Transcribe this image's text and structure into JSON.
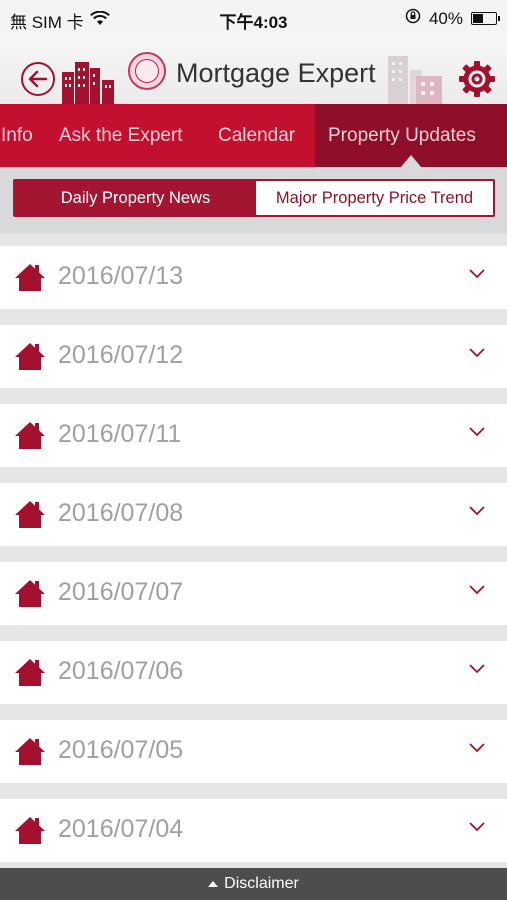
{
  "status_bar": {
    "carrier": "無 SIM 卡",
    "time": "下午4:03",
    "battery": "40%",
    "icons": [
      "wifi-icon",
      "orientation-lock-icon",
      "battery-icon"
    ]
  },
  "header": {
    "title": "Mortgage Expert",
    "icons": [
      "back-icon",
      "city-buildings-icon",
      "logo-seal",
      "gear-icon"
    ]
  },
  "tabs": [
    {
      "label": "Info"
    },
    {
      "label": "Ask the Expert"
    },
    {
      "label": "Calendar"
    },
    {
      "label": "Property Updates"
    }
  ],
  "segments": {
    "daily": "Daily Property News",
    "trend": "Major Property Price Trend"
  },
  "list": [
    {
      "date": "2016/07/13"
    },
    {
      "date": "2016/07/12"
    },
    {
      "date": "2016/07/11"
    },
    {
      "date": "2016/07/08"
    },
    {
      "date": "2016/07/07"
    },
    {
      "date": "2016/07/06"
    },
    {
      "date": "2016/07/05"
    },
    {
      "date": "2016/07/04"
    }
  ],
  "footer": {
    "label": "Disclaimer"
  },
  "colors": {
    "brand_red": "#c41030",
    "dark_red": "#8f0f2a",
    "date_gray": "#a0a0a0"
  }
}
